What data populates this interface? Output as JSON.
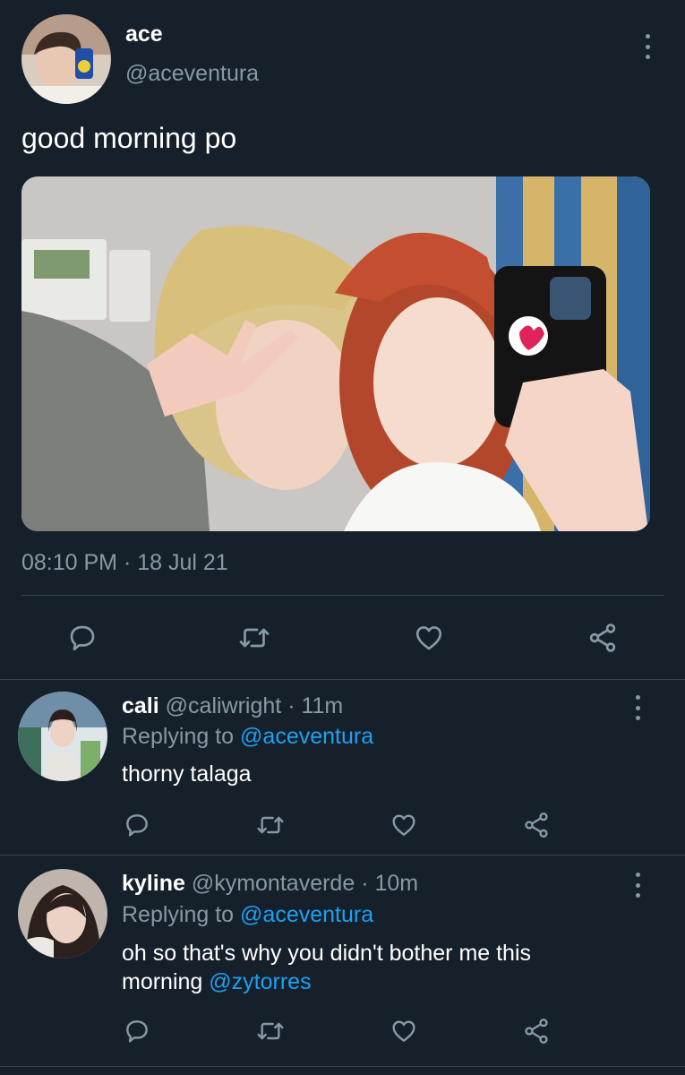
{
  "main_tweet": {
    "display_name": "ace",
    "handle": "@aceventura",
    "text": "good morning po",
    "timestamp": "08:10 PM · 18 Jul 21",
    "photo_alt": "selfie"
  },
  "replies": [
    {
      "display_name": "cali",
      "handle": "@caliwright",
      "time": "· 11m",
      "replying_prefix": "Replying to",
      "replying_to": "@aceventura",
      "text": "thorny talaga"
    },
    {
      "display_name": "kyline",
      "handle": "@kymontaverde",
      "time": "· 10m",
      "replying_prefix": "Replying to",
      "replying_to": "@aceventura",
      "text_line1": "oh so that's why you didn't bother me this",
      "text_line2_prefix": "morning",
      "mention": "@zytorres"
    }
  ],
  "icons": [
    "comment-icon",
    "retweet-icon",
    "like-icon",
    "share-icon",
    "more-options-icon"
  ],
  "colors": {
    "background": "#15202b",
    "divider": "#38444d",
    "muted": "#8899a6",
    "link": "#1da1f2"
  }
}
